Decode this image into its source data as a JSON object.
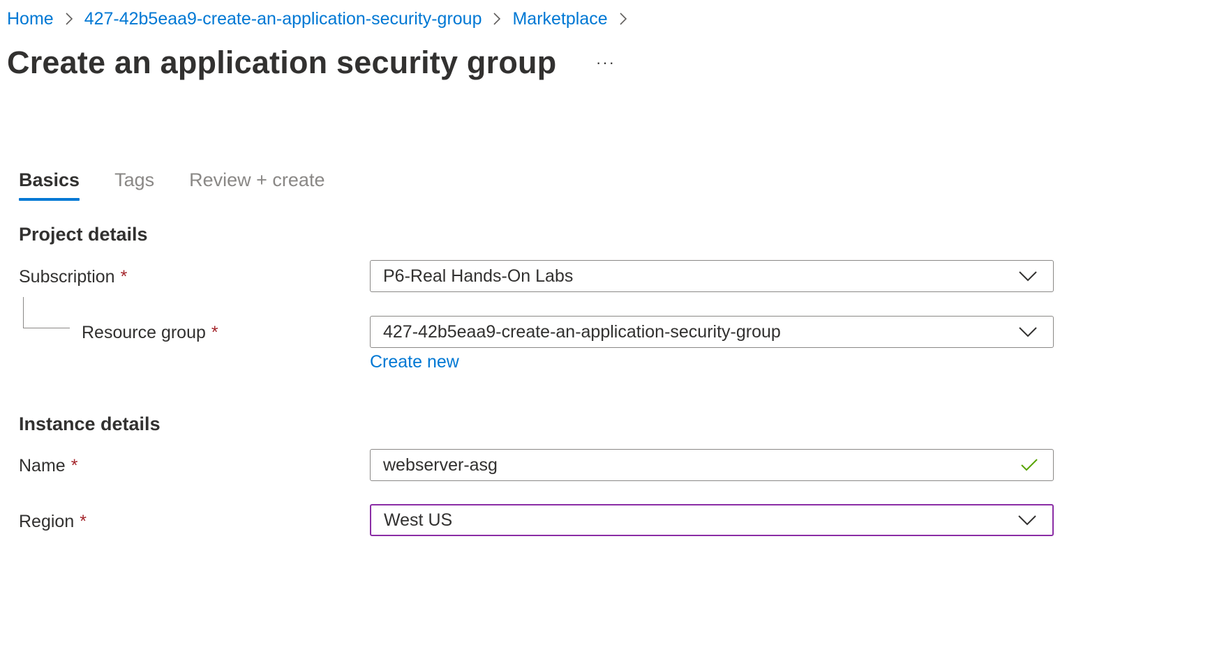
{
  "breadcrumb": {
    "items": [
      {
        "label": "Home"
      },
      {
        "label": "427-42b5eaa9-create-an-application-security-group"
      },
      {
        "label": "Marketplace"
      }
    ],
    "separator_icon": "chevron-right-icon"
  },
  "header": {
    "title": "Create an application security group",
    "more_label": "···"
  },
  "tabs": [
    {
      "label": "Basics",
      "active": true
    },
    {
      "label": "Tags",
      "active": false
    },
    {
      "label": "Review + create",
      "active": false
    }
  ],
  "project_details": {
    "heading": "Project details",
    "subscription": {
      "label": "Subscription",
      "required_mark": "*",
      "value": "P6-Real Hands-On Labs"
    },
    "resource_group": {
      "label": "Resource group",
      "required_mark": "*",
      "value": "427-42b5eaa9-create-an-application-security-group",
      "create_new_label": "Create new"
    }
  },
  "instance_details": {
    "heading": "Instance details",
    "name": {
      "label": "Name",
      "required_mark": "*",
      "value": "webserver-asg",
      "valid": true
    },
    "region": {
      "label": "Region",
      "required_mark": "*",
      "value": "West US",
      "focused": true
    }
  },
  "colors": {
    "link": "#0078d4",
    "required": "#a4262c",
    "focus_border": "#8a2da5",
    "valid_check": "#57a300",
    "tab_underline": "#0078d4"
  }
}
